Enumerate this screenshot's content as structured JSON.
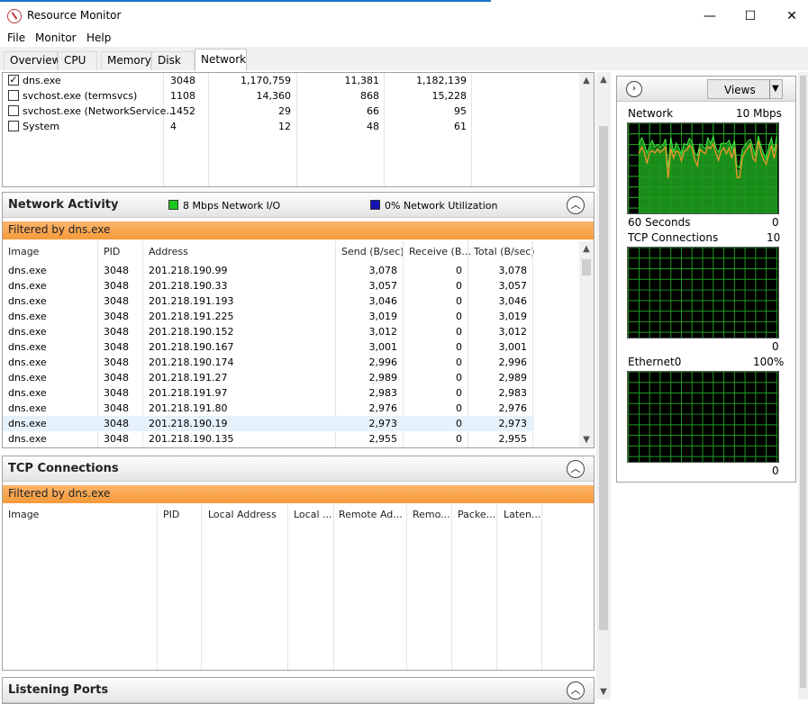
{
  "window": {
    "title": "Resource Monitor",
    "min": "—",
    "max": "☐",
    "close": "✕"
  },
  "menu": [
    "File",
    "Monitor",
    "Help"
  ],
  "tabs": [
    "Overview",
    "CPU",
    "Memory",
    "Disk",
    "Network"
  ],
  "active_tab": "Network",
  "processes": {
    "rows": [
      {
        "checked": true,
        "name": "dns.exe",
        "pid": "3048",
        "send": "1,170,759",
        "receive": "11,381",
        "total": "1,182,139"
      },
      {
        "checked": false,
        "name": "svchost.exe (termsvcs)",
        "pid": "1108",
        "send": "14,360",
        "receive": "868",
        "total": "15,228"
      },
      {
        "checked": false,
        "name": "svchost.exe (NetworkService...",
        "pid": "1452",
        "send": "29",
        "receive": "66",
        "total": "95"
      },
      {
        "checked": false,
        "name": "System",
        "pid": "4",
        "send": "12",
        "receive": "48",
        "total": "61"
      }
    ]
  },
  "network_activity": {
    "title": "Network Activity",
    "legend_io": "8 Mbps Network I/O",
    "legend_util": "0% Network Utilization",
    "io_color": "#1ec81e",
    "util_color": "#1414b4",
    "filter": "Filtered by dns.exe",
    "columns": [
      "Image",
      "PID",
      "Address",
      "Send (B/sec)",
      "Receive (B...",
      "Total (B/sec)"
    ],
    "rows": [
      [
        "dns.exe",
        "3048",
        "201.218.190.99",
        "3,078",
        "0",
        "3,078"
      ],
      [
        "dns.exe",
        "3048",
        "201.218.190.33",
        "3,057",
        "0",
        "3,057"
      ],
      [
        "dns.exe",
        "3048",
        "201.218.191.193",
        "3,046",
        "0",
        "3,046"
      ],
      [
        "dns.exe",
        "3048",
        "201.218.191.225",
        "3,019",
        "0",
        "3,019"
      ],
      [
        "dns.exe",
        "3048",
        "201.218.190.152",
        "3,012",
        "0",
        "3,012"
      ],
      [
        "dns.exe",
        "3048",
        "201.218.190.167",
        "3,001",
        "0",
        "3,001"
      ],
      [
        "dns.exe",
        "3048",
        "201.218.190.174",
        "2,996",
        "0",
        "2,996"
      ],
      [
        "dns.exe",
        "3048",
        "201.218.191.27",
        "2,989",
        "0",
        "2,989"
      ],
      [
        "dns.exe",
        "3048",
        "201.218.191.97",
        "2,983",
        "0",
        "2,983"
      ],
      [
        "dns.exe",
        "3048",
        "201.218.191.80",
        "2,976",
        "0",
        "2,976"
      ],
      [
        "dns.exe",
        "3048",
        "201.218.190.19",
        "2,973",
        "0",
        "2,973"
      ],
      [
        "dns.exe",
        "3048",
        "201.218.190.135",
        "2,955",
        "0",
        "2,955"
      ]
    ],
    "selected_row": 10
  },
  "tcp_connections": {
    "title": "TCP Connections",
    "filter": "Filtered by dns.exe",
    "columns": [
      "Image",
      "PID",
      "Local Address",
      "Local ...",
      "Remote Ad...",
      "Remo...",
      "Packe...",
      "Laten..."
    ]
  },
  "listening_ports": {
    "title": "Listening Ports"
  },
  "right_panel": {
    "views_label": "Views",
    "graphs": [
      {
        "title": "Network",
        "scale": "10 Mbps",
        "footer_left": "60 Seconds",
        "footer_right": "0"
      },
      {
        "title": "TCP Connections",
        "scale": "10",
        "footer_left": "",
        "footer_right": "0"
      },
      {
        "title": "Ethernet0",
        "scale": "100%",
        "footer_left": "",
        "footer_right": "0"
      }
    ]
  },
  "colors": {
    "filter_orange": "#f59a3a",
    "graph_grid": "#1e9a1e",
    "line_green": "#3ce63c",
    "line_orange": "#e6962d"
  }
}
